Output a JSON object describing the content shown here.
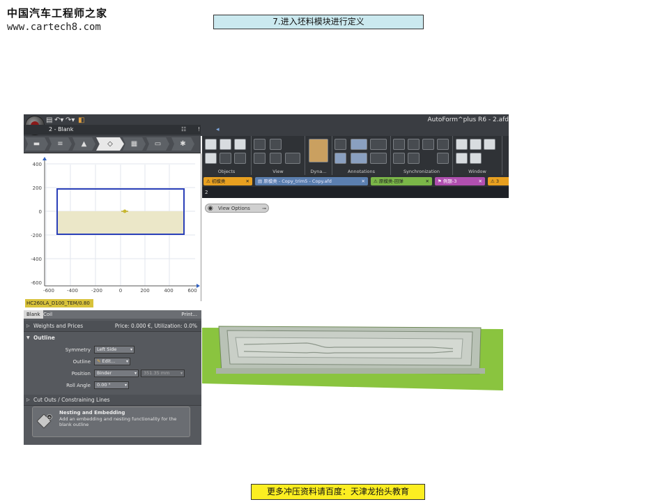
{
  "watermark": {
    "cn": "中国汽车工程师之家",
    "url": "www.cartech8.com"
  },
  "slide_title": "7.进入坯料模块进行定义",
  "footer_note": "更多冲压资料请百度：天津龙抬头教育",
  "app": {
    "window_title": "AutoForm^plus R6 - 2.afd",
    "panel_title": "2 - Blank",
    "panel_header_icons": [
      "!",
      "☷"
    ],
    "panel_tabs": [
      "file-icon",
      "steps-icon",
      "die-icon",
      "blank-icon",
      "press-icon",
      "monitor-icon",
      "robot-icon"
    ],
    "active_panel_tab": 3,
    "graph": {
      "y_ticks": [
        "400",
        "200",
        "0",
        "-200",
        "-400",
        "-600"
      ],
      "x_ticks": [
        "-600",
        "-400",
        "-200",
        "0",
        "200",
        "400",
        "600"
      ],
      "outline_color": "#2a3fb8",
      "fill_color": "#ebe7c8"
    },
    "material_label": "HC260LA_D100_TEM/0.80 mm",
    "subtabs": [
      "Blank",
      "Coil"
    ],
    "print_label": "Print...",
    "weights": {
      "label": "Weights and Prices",
      "summary": "Price: 0.000 €, Utilization: 0.0%"
    },
    "outline_section": "Outline",
    "fields": {
      "symmetry": {
        "label": "Symmetry",
        "value": "Left Side"
      },
      "outline": {
        "label": "Outline",
        "value": "Edit..."
      },
      "position": {
        "label": "Position",
        "value": "Binder",
        "extra": "351.35 mm"
      },
      "roll_angle": {
        "label": "Roll Angle",
        "value": "0.00 °"
      }
    },
    "cutouts": "Cut Outs / Constraining Lines",
    "nesting": {
      "title": "Nesting and Embedding",
      "desc": "Add an embedding and nesting functionality for the blank outline"
    },
    "ribbon_groups": [
      "Objects",
      "View",
      "Dyna...",
      "Annotations",
      "Synchronization",
      "Window"
    ],
    "file_tabs": [
      {
        "label": "初模类",
        "color": "#e8a020",
        "icon": "warning-icon"
      },
      {
        "label": "原模类 - Copy_trim5 - Copy.afd",
        "color": "#5b7fb0",
        "icon": "file-icon"
      },
      {
        "label": "原模类-回弹",
        "color": "#7ab648",
        "icon": "warning-icon"
      },
      {
        "label": "例题-3",
        "color": "#b04fb0",
        "icon": "flag-icon"
      },
      {
        "label": "3",
        "color": "#e8a020",
        "icon": "warning-icon"
      }
    ],
    "crumb": "2",
    "view_options": "View Options",
    "part_color": "#8ac43f"
  }
}
